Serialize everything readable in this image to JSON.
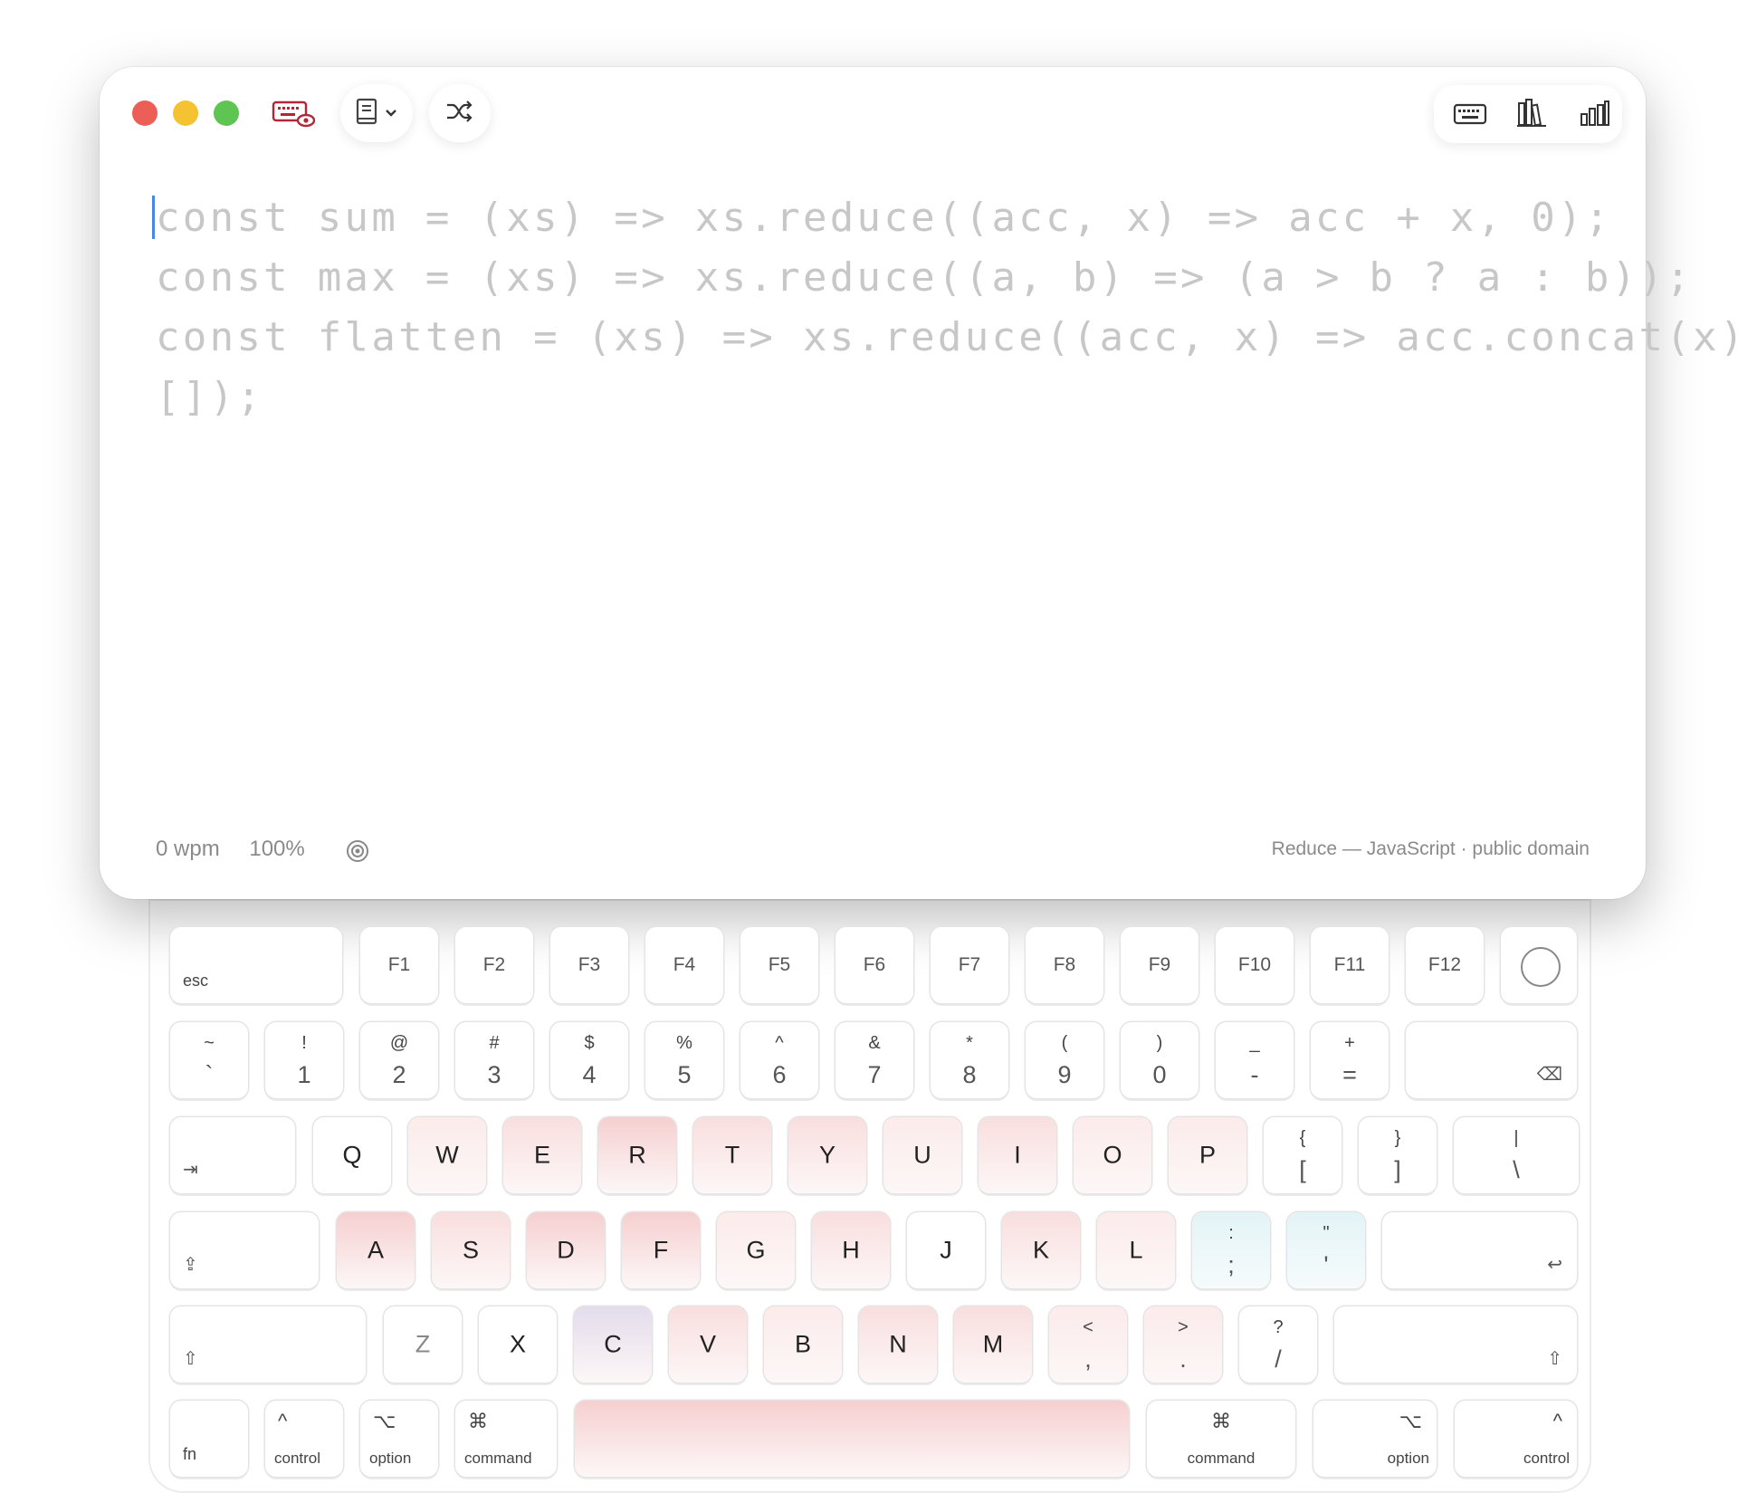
{
  "toolbar": {
    "keyboard_preview_icon": "keyboard-eye-icon",
    "lessons_icon": "book-icon",
    "dropdown_icon": "chevron-down-icon",
    "shuffle_icon": "shuffle-icon",
    "right_icons": [
      "keyboard-icon",
      "library-icon",
      "bar-chart-icon"
    ]
  },
  "editor": {
    "lines": [
      "const sum = (xs) => xs.reduce((acc, x) => acc + x, 0);",
      "const max = (xs) => xs.reduce((a, b) => (a > b ? a : b));",
      "const flatten = (xs) => xs.reduce((acc, x) => acc.concat(x),",
      "[]);"
    ],
    "text_color": "#c7c7c7",
    "caret_color": "#4a86e8"
  },
  "status": {
    "wpm": "0 wpm",
    "accuracy": "100%",
    "target_icon": "target-icon",
    "source": "Reduce — JavaScript · public domain"
  },
  "keyboard": {
    "heat_colors": {
      "strong": "#f6cfd0",
      "medium": "#f9dede",
      "light": "#fcebeb",
      "cyan": "#e3f4f6",
      "purple": "#e3dcec"
    },
    "row_function": {
      "esc": "esc",
      "fkeys": [
        "F1",
        "F2",
        "F3",
        "F4",
        "F5",
        "F6",
        "F7",
        "F8",
        "F9",
        "F10",
        "F11",
        "F12"
      ]
    },
    "row_numbers": [
      {
        "top": "~",
        "bot": "`"
      },
      {
        "top": "!",
        "bot": "1"
      },
      {
        "top": "@",
        "bot": "2"
      },
      {
        "top": "#",
        "bot": "3"
      },
      {
        "top": "$",
        "bot": "4"
      },
      {
        "top": "%",
        "bot": "5"
      },
      {
        "top": "^",
        "bot": "6"
      },
      {
        "top": "&",
        "bot": "7"
      },
      {
        "top": "*",
        "bot": "8"
      },
      {
        "top": "(",
        "bot": "9"
      },
      {
        "top": ")",
        "bot": "0"
      },
      {
        "top": "_",
        "bot": "-"
      },
      {
        "top": "+",
        "bot": "="
      }
    ],
    "delete_glyph": "⌫",
    "tab_glyph": "⇥",
    "row_q": [
      "Q",
      "W",
      "E",
      "R",
      "T",
      "Y",
      "U",
      "I",
      "O",
      "P"
    ],
    "row_q_punct": [
      {
        "top": "{",
        "bot": "["
      },
      {
        "top": "}",
        "bot": "]"
      },
      {
        "top": "|",
        "bot": "\\"
      }
    ],
    "caps_glyph": "⇪",
    "row_a": [
      "A",
      "S",
      "D",
      "F",
      "G",
      "H",
      "J",
      "K",
      "L"
    ],
    "row_a_punct": [
      {
        "top": ":",
        "bot": ";"
      },
      {
        "top": "\"",
        "bot": "'"
      }
    ],
    "return_glyph": "↩",
    "shift_glyph": "⇧",
    "row_z": [
      "Z",
      "X",
      "C",
      "V",
      "B",
      "N",
      "M"
    ],
    "row_z_punct": [
      {
        "top": "<",
        "bot": ","
      },
      {
        "top": ">",
        "bot": "."
      },
      {
        "top": "?",
        "bot": "/"
      }
    ],
    "bottom": {
      "fn": "fn",
      "control_sym": "^",
      "control": "control",
      "option_sym": "⌥",
      "option": "option",
      "command_sym": "⌘",
      "command": "command"
    }
  }
}
